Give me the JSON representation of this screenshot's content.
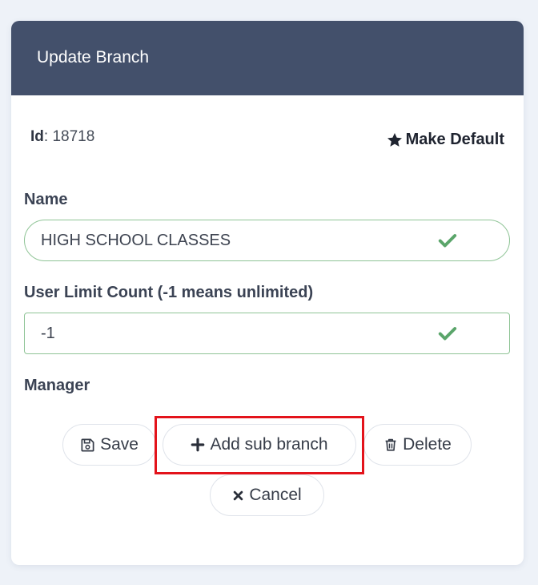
{
  "header": {
    "title": "Update Branch"
  },
  "record": {
    "id_label": "Id",
    "id_separator": ": ",
    "id_value": "18718",
    "make_default_label": "Make Default"
  },
  "form": {
    "name_label": "Name",
    "name_value": "HIGH SCHOOL CLASSES",
    "user_limit_label": "User Limit Count (-1 means unlimited)",
    "user_limit_value": "-1",
    "manager_label": "Manager"
  },
  "actions": {
    "save_label": "Save",
    "add_sub_branch_label": "Add sub branch",
    "delete_label": "Delete",
    "cancel_label": "Cancel"
  },
  "icons": {
    "make_default": "star-icon",
    "valid": "check-icon",
    "save": "floppy-disk-icon",
    "add": "plus-icon",
    "delete": "trash-icon",
    "cancel": "x-icon"
  },
  "colors": {
    "header_bg": "#43506b",
    "valid_border": "#8fc496",
    "valid_check": "#5aa56a",
    "highlight": "#e3131b"
  }
}
